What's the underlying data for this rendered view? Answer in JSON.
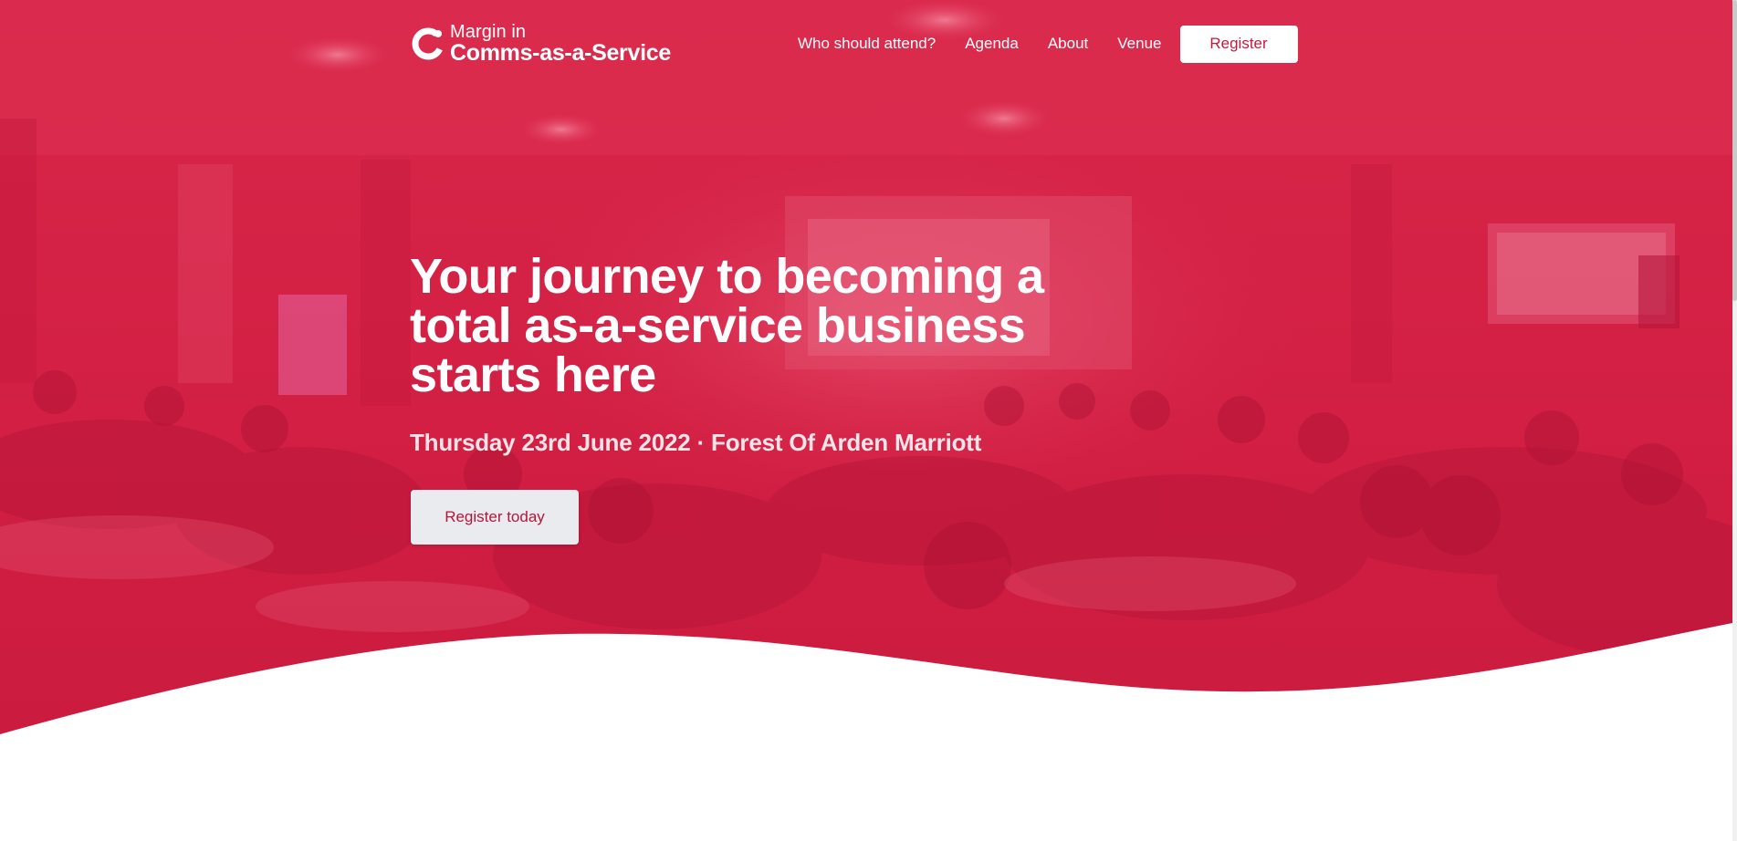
{
  "brand": {
    "line1": "Margin in",
    "line2": "Comms-as-a-Service",
    "logo_icon": "ring-logo-icon"
  },
  "nav": {
    "items": [
      {
        "label": "Who should attend?"
      },
      {
        "label": "Agenda"
      },
      {
        "label": "About"
      },
      {
        "label": "Venue"
      }
    ],
    "register_label": "Register"
  },
  "hero": {
    "title": "Your journey to becoming a total as-a-service business starts here",
    "subtitle": "Thursday 23rd June 2022 · Forest Of Arden Marriott",
    "cta_label": "Register today",
    "background": "conference-room-photo-red-tint"
  },
  "colors": {
    "brand_red": "#d81f43",
    "button_text": "#c8193c",
    "cta_bg": "#e9ebef"
  }
}
